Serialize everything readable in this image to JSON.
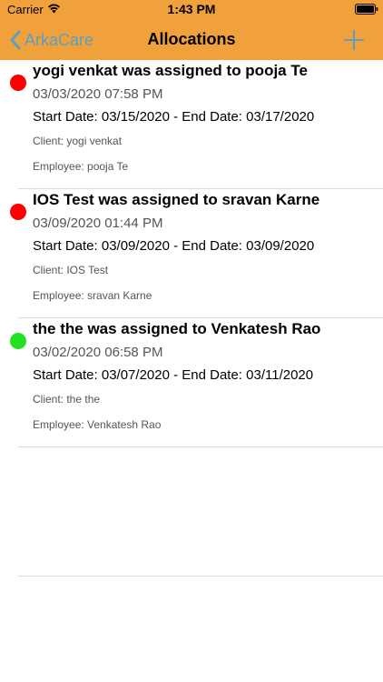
{
  "status_bar": {
    "carrier": "Carrier",
    "time": "1:43 PM",
    "wifi_icon": "wifi-icon",
    "battery_icon": "battery-full-icon"
  },
  "nav": {
    "back_label": "ArkaCare",
    "back_icon": "chevron-left-icon",
    "title": "Allocations",
    "add_icon": "plus-icon"
  },
  "colors": {
    "header_bg": "#F0A13C",
    "tint": "#5A9FC4",
    "status_red": "#FF0000",
    "status_green": "#22E022"
  },
  "allocations": [
    {
      "status": "red",
      "title": "yogi venkat was assigned to pooja Te",
      "created": "03/03/2020 07:58 PM",
      "dates": "Start Date: 03/15/2020 - End Date: 03/17/2020",
      "client": "Client: yogi venkat",
      "employee": "Employee: pooja Te"
    },
    {
      "status": "red",
      "title": "IOS Test was assigned to sravan Karne",
      "created": "03/09/2020 01:44 PM",
      "dates": "Start Date: 03/09/2020 - End Date: 03/09/2020",
      "client": "Client: IOS Test",
      "employee": "Employee: sravan Karne"
    },
    {
      "status": "green",
      "title": "the the was assigned to Venkatesh Rao",
      "created": "03/02/2020 06:58 PM",
      "dates": "Start Date: 03/07/2020 - End Date: 03/11/2020",
      "client": "Client: the the",
      "employee": "Employee: Venkatesh Rao"
    }
  ]
}
